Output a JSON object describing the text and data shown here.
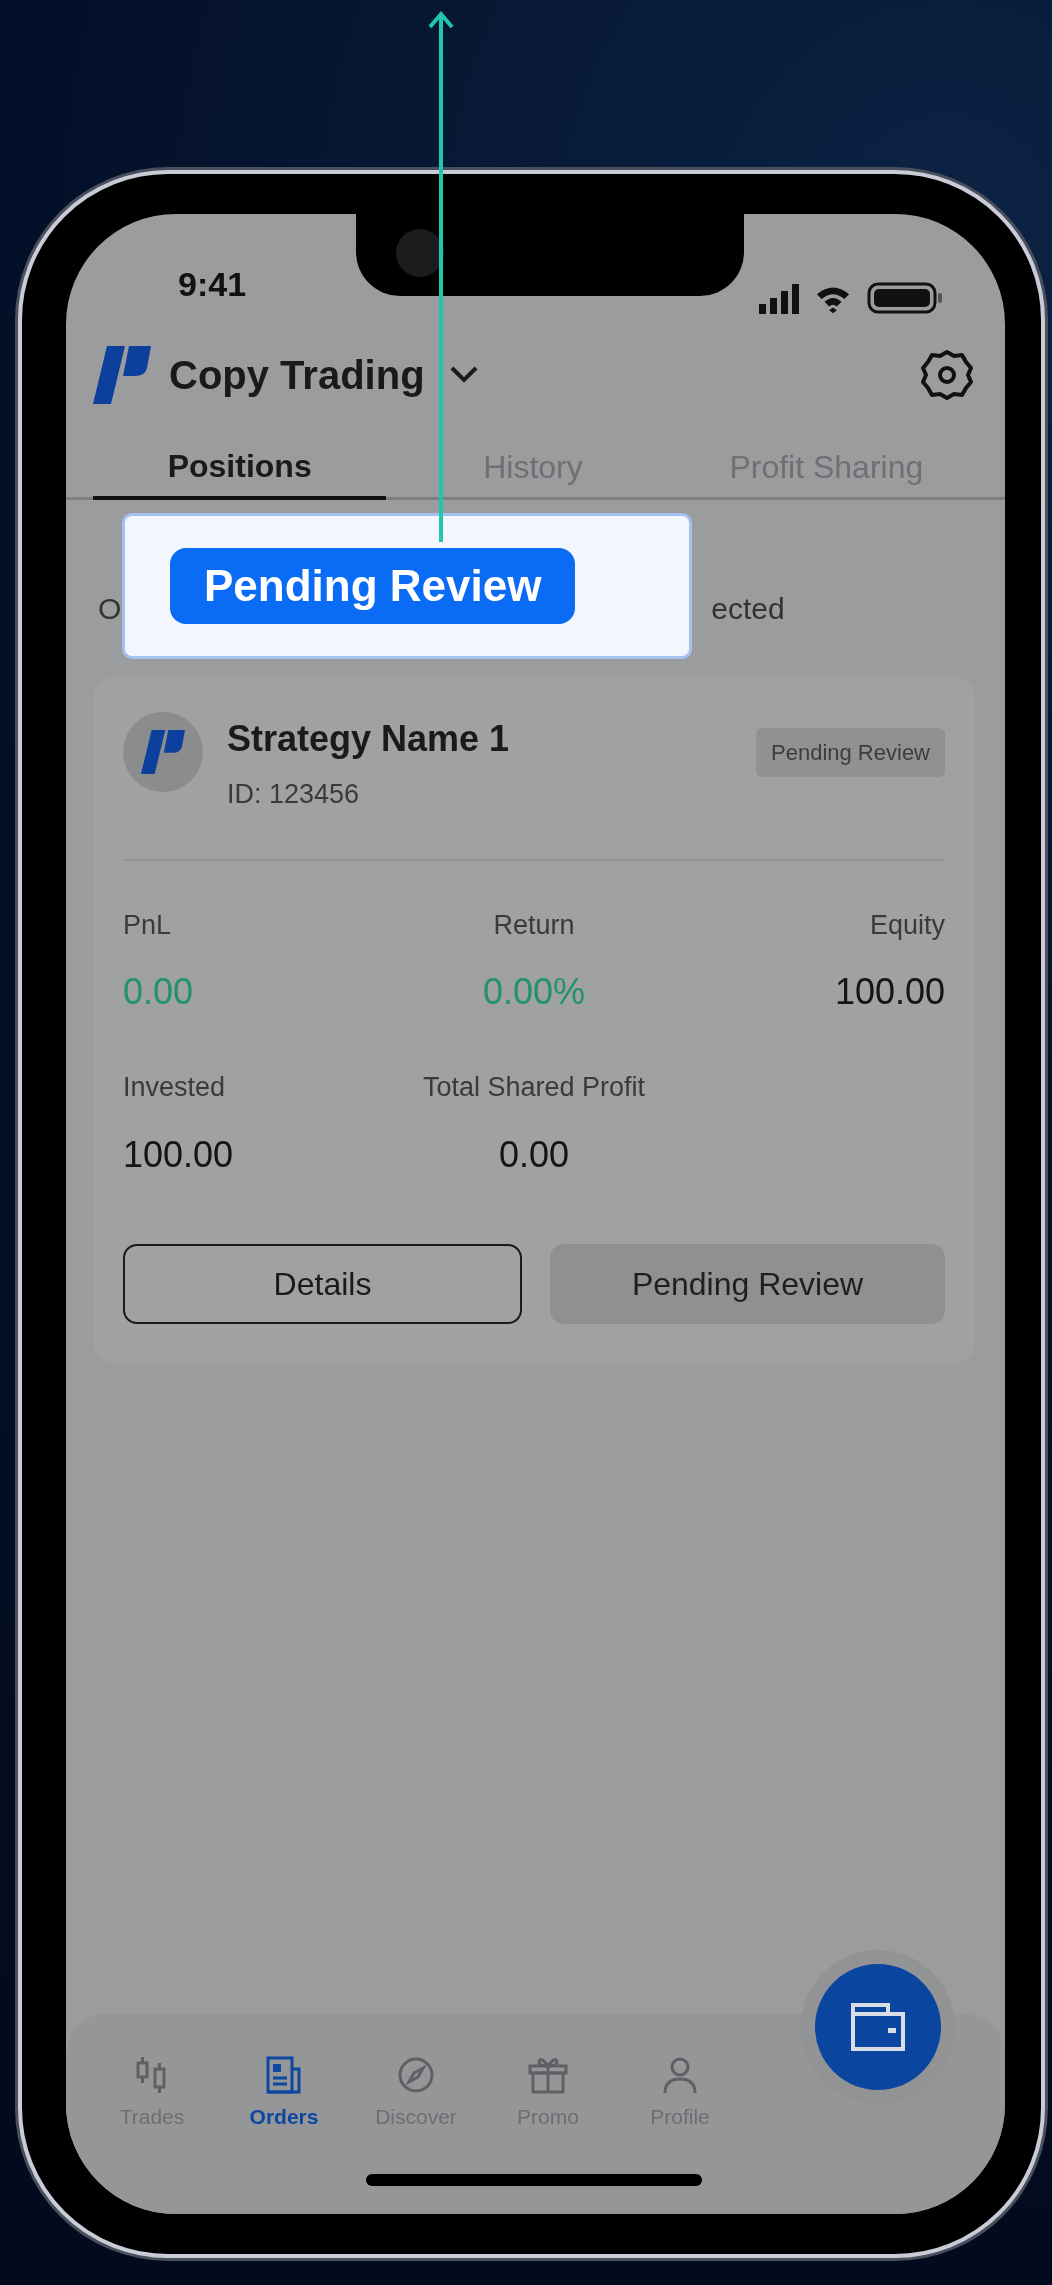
{
  "status_bar": {
    "time": "9:41"
  },
  "header": {
    "title": "Copy Trading"
  },
  "tabs": [
    {
      "label": "Positions",
      "selected": true
    },
    {
      "label": "History",
      "selected": false
    },
    {
      "label": "Profit Sharing",
      "selected": false
    }
  ],
  "filters": [
    {
      "label": "O"
    },
    {
      "label": "ected"
    }
  ],
  "card": {
    "name": "Strategy Name 1",
    "id": "ID: 123456",
    "status": "Pending Review",
    "metrics": [
      {
        "label": "PnL",
        "value": "0.00",
        "positive": true
      },
      {
        "label": "Return",
        "value": "0.00%",
        "positive": true
      },
      {
        "label": "Equity",
        "value": "100.00",
        "positive": false
      },
      {
        "label": "Invested",
        "value": "100.00",
        "positive": false
      },
      {
        "label": "Total Shared Profit",
        "value": "0.00",
        "positive": false
      }
    ],
    "buttons": [
      {
        "label": "Details",
        "kind": "outline"
      },
      {
        "label": "Pending Review",
        "kind": "disabled"
      }
    ]
  },
  "bottom_nav": [
    {
      "label": "Trades",
      "selected": false
    },
    {
      "label": "Orders",
      "selected": true
    },
    {
      "label": "Discover",
      "selected": false
    },
    {
      "label": "Promo",
      "selected": false
    },
    {
      "label": "Profile",
      "selected": false
    }
  ],
  "callout": {
    "label": "Pending Review"
  }
}
